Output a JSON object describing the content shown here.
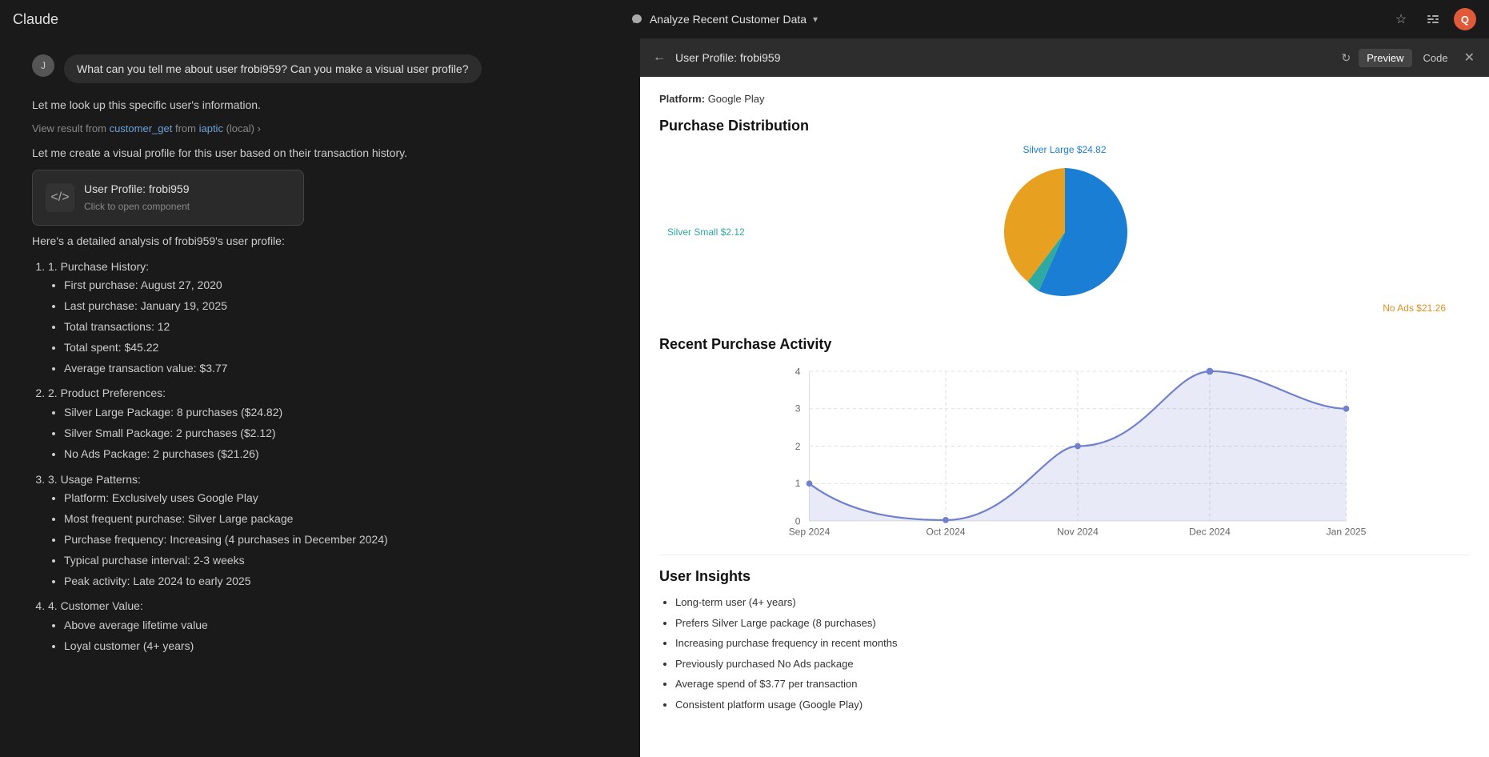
{
  "app": {
    "logo": "Claude",
    "title": "Analyze Recent Customer Data",
    "title_chevron": "▾"
  },
  "topbar": {
    "star_icon": "☆",
    "settings_icon": "⚙",
    "avatar_initials": "Q"
  },
  "chat": {
    "user_message": "What can you tell me about user frobi959? Can you make a visual user profile?",
    "user_avatar": "J",
    "assistant_intro": "Let me look up this specific user's information.",
    "tool_link_text": "View result from ",
    "tool_fn": "customer_get",
    "tool_from": "from",
    "tool_source": "iaptic",
    "tool_local": "(local)",
    "assistant_create": "Let me create a visual profile for this user based on their transaction history.",
    "component": {
      "icon": "</>",
      "title": "User Profile: frobi959",
      "subtitle": "Click to open component"
    },
    "analysis_intro": "Here's a detailed analysis of frobi959's user profile:",
    "sections": [
      {
        "title": "1. Purchase History:",
        "items": [
          "First purchase: August 27, 2020",
          "Last purchase: January 19, 2025",
          "Total transactions: 12",
          "Total spent: $45.22",
          "Average transaction value: $3.77"
        ]
      },
      {
        "title": "2. Product Preferences:",
        "items": [
          "Silver Large Package: 8 purchases ($24.82)",
          "Silver Small Package: 2 purchases ($2.12)",
          "No Ads Package: 2 purchases ($21.26)"
        ]
      },
      {
        "title": "3. Usage Patterns:",
        "items": [
          "Platform: Exclusively uses Google Play",
          "Most frequent purchase: Silver Large package",
          "Purchase frequency: Increasing (4 purchases in December 2024)",
          "Typical purchase interval: 2-3 weeks",
          "Peak activity: Late 2024 to early 2025"
        ]
      },
      {
        "title": "4. Customer Value:",
        "items": [
          "Above average lifetime value",
          "Loyal customer (4+ years)"
        ]
      }
    ]
  },
  "panel": {
    "title": "User Profile: frobi959",
    "preview_label": "Preview",
    "code_label": "Code",
    "platform_label": "Platform:",
    "platform_value": "Google Play",
    "purchase_distribution_title": "Purchase Distribution",
    "pie_data": [
      {
        "label": "Silver Large $24.82",
        "value": 24.82,
        "color": "#1a7fd4",
        "angle_start": 0,
        "angle_end": 198
      },
      {
        "label": "Silver Small $2.12",
        "value": 2.12,
        "color": "#2eaaa0",
        "angle_start": 198,
        "angle_end": 215
      },
      {
        "label": "No Ads $21.26",
        "value": 21.26,
        "color": "#e09020",
        "angle_start": 215,
        "angle_end": 360
      }
    ],
    "recent_activity_title": "Recent Purchase Activity",
    "chart_x_labels": [
      "Sep 2024",
      "Oct 2024",
      "Nov 2024",
      "Dec 2024",
      "Jan 2025"
    ],
    "chart_y_labels": [
      "0",
      "1",
      "2",
      "3",
      "4"
    ],
    "chart_points": [
      {
        "x": 0,
        "y": 1
      },
      {
        "x": 0.25,
        "y": 0.1
      },
      {
        "x": 0.5,
        "y": 2
      },
      {
        "x": 0.75,
        "y": 4
      },
      {
        "x": 1.0,
        "y": 3
      }
    ],
    "user_insights_title": "User Insights",
    "insights": [
      "Long-term user (4+ years)",
      "Prefers Silver Large package (8 purchases)",
      "Increasing purchase frequency in recent months",
      "Previously purchased No Ads package",
      "Average spend of $3.77 per transaction",
      "Consistent platform usage (Google Play)"
    ]
  }
}
